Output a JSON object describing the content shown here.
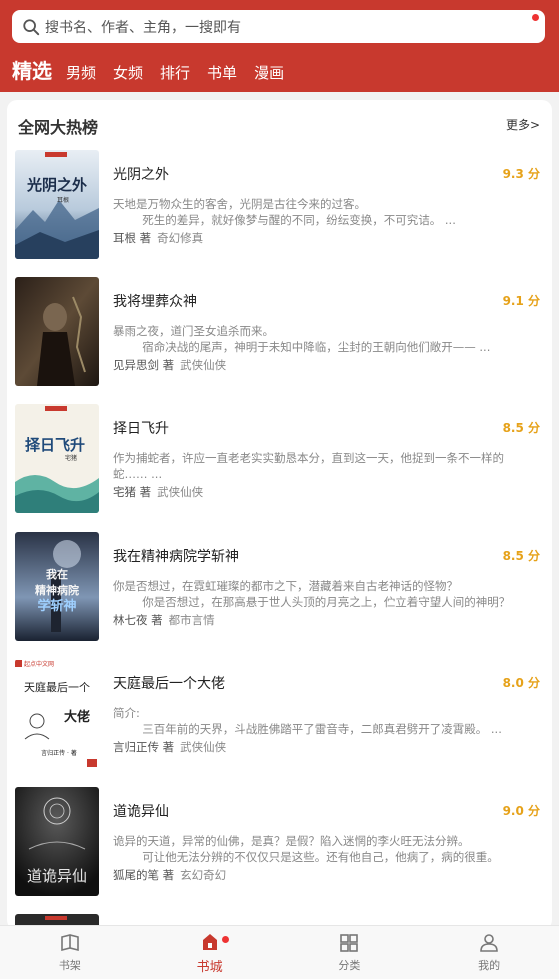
{
  "search": {
    "placeholder": "搜书名、作者、主角，一搜即有"
  },
  "tabs": [
    {
      "label": "精选"
    },
    {
      "label": "男频"
    },
    {
      "label": "女频"
    },
    {
      "label": "排行"
    },
    {
      "label": "书单"
    },
    {
      "label": "漫画"
    }
  ],
  "section": {
    "title": "全网大热榜",
    "more": "更多>"
  },
  "books": [
    {
      "title": "光阴之外",
      "score": "9.3 分",
      "desc": "天地是万物众生的客舍，光阴是古往今来的过客。\n        死生的差异，就好像梦与醒的不同，纷纭变换，不可究诘。 ...",
      "author": "耳根 著",
      "genre": "奇幻修真",
      "cover_text": "光阴之外",
      "cover_sub": "耳根",
      "cover_colors": [
        "#dfe9f1",
        "#3b5f84"
      ]
    },
    {
      "title": "我将埋葬众神",
      "score": "9.1 分",
      "desc": "暴雨之夜，道门圣女追杀而来。\n        宿命决战的尾声，神明于未知中降临，尘封的王朝向他们敞开—— ...",
      "author": "见异思剑 著",
      "genre": "武侠仙侠",
      "cover_text": "",
      "cover_sub": "",
      "cover_colors": [
        "#3a2c22",
        "#6e5a44"
      ]
    },
    {
      "title": "择日飞升",
      "score": "8.5 分",
      "desc": "作为捕蛇者，许应一直老老实实勤恳本分，直到这一天，他捉到一条不一样的蛇…… ...",
      "author": "宅猪 著",
      "genre": "武侠仙侠",
      "cover_text": "择日飞升",
      "cover_sub": "宅猪",
      "cover_colors": [
        "#f2efe6",
        "#3b9a8e"
      ]
    },
    {
      "title": "我在精神病院学斩神",
      "score": "8.5 分",
      "desc": "你是否想过，在霓虹璀璨的都市之下，潜藏着来自古老神话的怪物？\n        你是否想过，在那高悬于世人头顶的月亮之上，伫立着守望人间的神明？ ...",
      "author": "林七夜 著",
      "genre": "都市言情",
      "cover_text": "精神病院学斩神",
      "cover_sub": "",
      "cover_colors": [
        "#1c2636",
        "#6e8db0"
      ]
    },
    {
      "title": "天庭最后一个大佬",
      "score": "8.0 分",
      "desc": "简介:\n        三百年前的天界，斗战胜佛踏平了雷音寺，二郎真君劈开了凌霄殿。 ...",
      "author": "言归正传 著",
      "genre": "武侠仙侠",
      "cover_text": "天庭最后一个",
      "cover_sub": "大佬",
      "cover_colors": [
        "#ffffff",
        "#ffffff"
      ],
      "cover_brand": "起点中文网",
      "cover_author": "言归正传 · 著"
    },
    {
      "title": "道诡异仙",
      "score": "9.0 分",
      "desc": "诡异的天道，异常的仙佛，是真？是假？陷入迷惘的李火旺无法分辨。\n        可让他无法分辨的不仅仅只是这些。还有他自己，他病了，病的很重。",
      "author": "狐尾的笔 著",
      "genre": "玄幻奇幻",
      "cover_text": "道诡异仙",
      "cover_sub": "",
      "cover_colors": [
        "#121212",
        "#3d3d3d"
      ]
    }
  ],
  "nav": [
    {
      "label": "书架",
      "icon": "bookshelf-icon"
    },
    {
      "label": "书城",
      "icon": "bookstore-icon"
    },
    {
      "label": "分类",
      "icon": "category-icon"
    },
    {
      "label": "我的",
      "icon": "profile-icon"
    }
  ],
  "colors": {
    "brand": "#c8392e",
    "score": "#e6a21a"
  }
}
